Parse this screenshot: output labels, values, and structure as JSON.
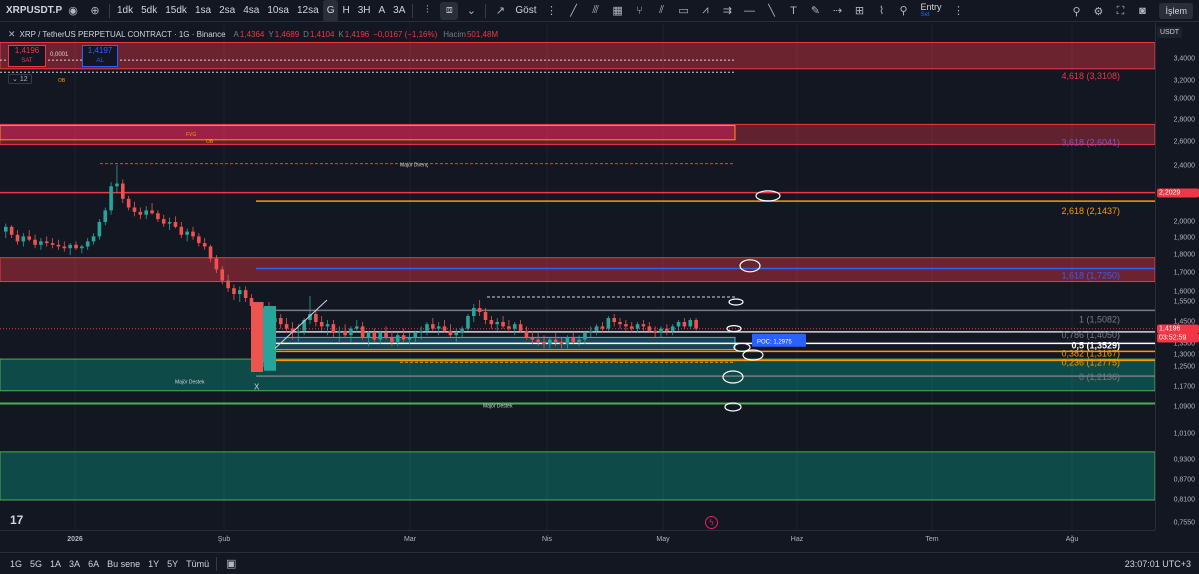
{
  "toolbar": {
    "symbol": "XRPUSDT.P",
    "intervals": [
      "1dk",
      "5dk",
      "15dk",
      "1sa",
      "2sa",
      "4sa",
      "10sa",
      "12sa",
      "G",
      "H",
      "3H",
      "A",
      "3A"
    ],
    "active_interval": "G",
    "indicators_label": "Göst",
    "entry_label": "Entry",
    "entry_sub": "Set",
    "publish_label": "İşlem"
  },
  "legend": {
    "title": "XRP / TetherUS PERPETUAL CONTRACT · 1G · Binance",
    "open_k": "A",
    "open": "1,4364",
    "high_k": "Y",
    "high": "1,4689",
    "low_k": "D",
    "low": "1,4104",
    "close_k": "K",
    "close": "1,4196",
    "change": "−0,0167 (−1,16%)",
    "volume_k": "Hacim",
    "volume": "501,48M",
    "sell_price": "1,4196",
    "sell_label": "SAT",
    "buy_price": "1,4197",
    "buy_label": "AL",
    "spread": "0,0001",
    "indicator_count": "12"
  },
  "price_axis": {
    "currency": "USDT",
    "labels": [
      "3,4000",
      "3,2000",
      "3,0000",
      "2,8000",
      "2,6000",
      "2,4000",
      "2,2000",
      "2,0000",
      "1,9000",
      "1,8000",
      "1,7000",
      "1,6000",
      "1,5500",
      "1,4500",
      "1,4000",
      "1,3500",
      "1,3000",
      "1,2500",
      "1,1700",
      "1,0900",
      "1,0100",
      "0,9300",
      "0,8700",
      "0,8100",
      "0,7550"
    ],
    "tag_resistance": "2,2029",
    "tag_price": "1,4196",
    "tag_timer": "03:52:59"
  },
  "fib_labels": {
    "f4618": "4,618 (3,3108)",
    "f3618": "3,618 (2,6041)",
    "f2618": "2,618 (2,1437)",
    "f1618": "1,618 (1,7250)",
    "f1": "1 (1,5082)",
    "f0786": "0,786 (1,4050)",
    "f05": "0,5 (1,3529)",
    "f0382": "0,382 (1,3167)",
    "f0236": "0,236 (1,2775)",
    "f0": "0 (1,2136)"
  },
  "annotations": {
    "major_resistance": "Majör Direnç",
    "major_support_left": "Majör Destek",
    "major_support_right": "Majör Destek",
    "poc": "POC: 1,2975",
    "fvg": "FVG",
    "ob_top": "OB",
    "ob_mid": "OB",
    "x_mark": "X"
  },
  "time_axis": {
    "labels": [
      "2026",
      "Şub",
      "Mar",
      "Nis",
      "May",
      "Haz",
      "Tem",
      "Ağu"
    ]
  },
  "bottombar": {
    "ranges": [
      "1G",
      "5G",
      "1A",
      "3A",
      "6A",
      "Bu sene",
      "1Y",
      "5Y",
      "Tümü"
    ],
    "clock": "23:07:01 UTC+3"
  },
  "chart_data": {
    "type": "candlestick",
    "note_source": "XRP/USDT daily",
    "colors": {
      "up": "#26a69a",
      "down": "#ef5350"
    },
    "candles": [
      [
        1.94,
        1.99,
        1.9,
        1.97
      ],
      [
        1.97,
        1.98,
        1.9,
        1.92
      ],
      [
        1.92,
        1.95,
        1.86,
        1.88
      ],
      [
        1.88,
        1.93,
        1.85,
        1.91
      ],
      [
        1.91,
        1.95,
        1.88,
        1.89
      ],
      [
        1.89,
        1.92,
        1.84,
        1.86
      ],
      [
        1.86,
        1.9,
        1.83,
        1.88
      ],
      [
        1.88,
        1.91,
        1.85,
        1.87
      ],
      [
        1.87,
        1.9,
        1.84,
        1.86
      ],
      [
        1.86,
        1.89,
        1.83,
        1.85
      ],
      [
        1.85,
        1.88,
        1.82,
        1.84
      ],
      [
        1.84,
        1.87,
        1.8,
        1.86
      ],
      [
        1.86,
        1.88,
        1.83,
        1.84
      ],
      [
        1.84,
        1.86,
        1.81,
        1.85
      ],
      [
        1.85,
        1.9,
        1.83,
        1.88
      ],
      [
        1.88,
        1.93,
        1.86,
        1.91
      ],
      [
        1.91,
        2.02,
        1.89,
        2.0
      ],
      [
        2.0,
        2.1,
        1.98,
        2.08
      ],
      [
        2.08,
        2.28,
        2.05,
        2.25
      ],
      [
        2.25,
        2.41,
        2.2,
        2.27
      ],
      [
        2.27,
        2.3,
        2.13,
        2.16
      ],
      [
        2.16,
        2.18,
        2.08,
        2.1
      ],
      [
        2.1,
        2.14,
        2.04,
        2.07
      ],
      [
        2.07,
        2.1,
        2.02,
        2.05
      ],
      [
        2.05,
        2.11,
        2.02,
        2.08
      ],
      [
        2.08,
        2.13,
        2.05,
        2.06
      ],
      [
        2.06,
        2.08,
        2.0,
        2.02
      ],
      [
        2.02,
        2.05,
        1.97,
        1.99
      ],
      [
        1.99,
        2.03,
        1.95,
        2.0
      ],
      [
        2.0,
        2.04,
        1.96,
        1.97
      ],
      [
        1.97,
        2.0,
        1.9,
        1.92
      ],
      [
        1.92,
        1.96,
        1.88,
        1.94
      ],
      [
        1.94,
        1.97,
        1.89,
        1.91
      ],
      [
        1.91,
        1.93,
        1.85,
        1.87
      ],
      [
        1.87,
        1.9,
        1.83,
        1.85
      ],
      [
        1.85,
        1.86,
        1.76,
        1.78
      ],
      [
        1.78,
        1.8,
        1.7,
        1.72
      ],
      [
        1.72,
        1.74,
        1.64,
        1.66
      ],
      [
        1.66,
        1.69,
        1.6,
        1.62
      ],
      [
        1.62,
        1.64,
        1.56,
        1.59
      ],
      [
        1.59,
        1.63,
        1.55,
        1.61
      ],
      [
        1.61,
        1.63,
        1.55,
        1.57
      ],
      [
        1.57,
        1.59,
        1.5,
        1.53
      ],
      [
        1.53,
        1.55,
        1.24,
        1.27
      ],
      [
        1.27,
        1.55,
        1.25,
        1.52
      ],
      [
        1.52,
        1.55,
        1.43,
        1.45
      ],
      [
        1.45,
        1.5,
        1.41,
        1.47
      ],
      [
        1.47,
        1.49,
        1.42,
        1.44
      ],
      [
        1.44,
        1.47,
        1.4,
        1.42
      ],
      [
        1.42,
        1.45,
        1.37,
        1.4
      ],
      [
        1.4,
        1.44,
        1.36,
        1.41
      ],
      [
        1.41,
        1.47,
        1.39,
        1.46
      ],
      [
        1.46,
        1.58,
        1.44,
        1.49
      ],
      [
        1.49,
        1.51,
        1.43,
        1.45
      ],
      [
        1.45,
        1.48,
        1.41,
        1.43
      ],
      [
        1.43,
        1.46,
        1.39,
        1.44
      ],
      [
        1.44,
        1.46,
        1.38,
        1.4
      ],
      [
        1.4,
        1.43,
        1.36,
        1.41
      ],
      [
        1.41,
        1.44,
        1.38,
        1.39
      ],
      [
        1.39,
        1.43,
        1.36,
        1.42
      ],
      [
        1.42,
        1.46,
        1.4,
        1.43
      ],
      [
        1.43,
        1.45,
        1.37,
        1.38
      ],
      [
        1.38,
        1.41,
        1.34,
        1.4
      ],
      [
        1.4,
        1.42,
        1.36,
        1.37
      ],
      [
        1.37,
        1.41,
        1.35,
        1.4
      ],
      [
        1.4,
        1.43,
        1.37,
        1.38
      ],
      [
        1.38,
        1.41,
        1.34,
        1.36
      ],
      [
        1.36,
        1.4,
        1.34,
        1.39
      ],
      [
        1.39,
        1.42,
        1.36,
        1.37
      ],
      [
        1.37,
        1.4,
        1.35,
        1.38
      ],
      [
        1.38,
        1.41,
        1.36,
        1.4
      ],
      [
        1.4,
        1.43,
        1.37,
        1.41
      ],
      [
        1.41,
        1.45,
        1.39,
        1.44
      ],
      [
        1.44,
        1.47,
        1.41,
        1.42
      ],
      [
        1.42,
        1.45,
        1.39,
        1.43
      ],
      [
        1.43,
        1.46,
        1.4,
        1.41
      ],
      [
        1.41,
        1.44,
        1.38,
        1.39
      ],
      [
        1.39,
        1.42,
        1.36,
        1.4
      ],
      [
        1.4,
        1.43,
        1.38,
        1.42
      ],
      [
        1.42,
        1.49,
        1.41,
        1.48
      ],
      [
        1.48,
        1.54,
        1.45,
        1.52
      ],
      [
        1.52,
        1.56,
        1.48,
        1.5
      ],
      [
        1.5,
        1.52,
        1.44,
        1.46
      ],
      [
        1.46,
        1.48,
        1.42,
        1.44
      ],
      [
        1.44,
        1.47,
        1.41,
        1.45
      ],
      [
        1.45,
        1.48,
        1.42,
        1.43
      ],
      [
        1.43,
        1.46,
        1.4,
        1.42
      ],
      [
        1.42,
        1.45,
        1.39,
        1.44
      ],
      [
        1.44,
        1.46,
        1.4,
        1.41
      ],
      [
        1.41,
        1.43,
        1.37,
        1.38
      ],
      [
        1.38,
        1.41,
        1.35,
        1.37
      ],
      [
        1.37,
        1.4,
        1.34,
        1.36
      ],
      [
        1.36,
        1.39,
        1.33,
        1.35
      ],
      [
        1.35,
        1.38,
        1.33,
        1.37
      ],
      [
        1.37,
        1.4,
        1.34,
        1.36
      ],
      [
        1.36,
        1.38,
        1.33,
        1.35
      ],
      [
        1.35,
        1.39,
        1.33,
        1.38
      ],
      [
        1.38,
        1.4,
        1.35,
        1.36
      ],
      [
        1.36,
        1.39,
        1.34,
        1.37
      ],
      [
        1.37,
        1.41,
        1.35,
        1.4
      ],
      [
        1.4,
        1.43,
        1.38,
        1.41
      ],
      [
        1.41,
        1.44,
        1.39,
        1.43
      ],
      [
        1.43,
        1.45,
        1.4,
        1.42
      ],
      [
        1.42,
        1.48,
        1.41,
        1.47
      ],
      [
        1.47,
        1.49,
        1.43,
        1.45
      ],
      [
        1.45,
        1.47,
        1.42,
        1.44
      ],
      [
        1.44,
        1.46,
        1.41,
        1.43
      ],
      [
        1.43,
        1.45,
        1.4,
        1.42
      ],
      [
        1.42,
        1.45,
        1.4,
        1.44
      ],
      [
        1.44,
        1.46,
        1.41,
        1.43
      ],
      [
        1.43,
        1.45,
        1.4,
        1.41
      ],
      [
        1.41,
        1.43,
        1.38,
        1.4
      ],
      [
        1.4,
        1.43,
        1.38,
        1.42
      ],
      [
        1.42,
        1.44,
        1.39,
        1.41
      ],
      [
        1.41,
        1.44,
        1.39,
        1.43
      ],
      [
        1.43,
        1.46,
        1.41,
        1.45
      ],
      [
        1.45,
        1.47,
        1.42,
        1.43
      ],
      [
        1.43,
        1.47,
        1.42,
        1.46
      ],
      [
        1.46,
        1.47,
        1.41,
        1.42
      ]
    ],
    "zones": [
      {
        "type": "resistance",
        "from": 3.3108,
        "to": 3.55,
        "color": "#f23645"
      },
      {
        "type": "resistance",
        "from": 2.58,
        "to": 2.75,
        "color": "#f23645"
      },
      {
        "type": "fvg",
        "from": 2.58,
        "to": 2.76,
        "color": "#e91e63"
      },
      {
        "type": "resistance",
        "from": 1.66,
        "to": 1.78,
        "color": "#f23645"
      },
      {
        "type": "support",
        "from": 1.1,
        "to": 1.28,
        "color": "#089981"
      },
      {
        "type": "support",
        "from": 0.81,
        "to": 0.95,
        "color": "#089981"
      }
    ],
    "levels": [
      {
        "value": 2.2029,
        "color": "#f23645"
      },
      {
        "value": 2.1437,
        "color": "#ff9800"
      },
      {
        "value": 1.725,
        "color": "#2962ff"
      },
      {
        "value": 1.5082,
        "color": "#787b86"
      },
      {
        "value": 1.405,
        "color": "#d1d4dc"
      },
      {
        "value": 1.3529,
        "color": "#ffffff"
      },
      {
        "value": 1.3167,
        "color": "#ff9800"
      },
      {
        "value": 1.2775,
        "color": "#ff9800"
      },
      {
        "value": 1.2136,
        "color": "#787b86"
      }
    ]
  }
}
